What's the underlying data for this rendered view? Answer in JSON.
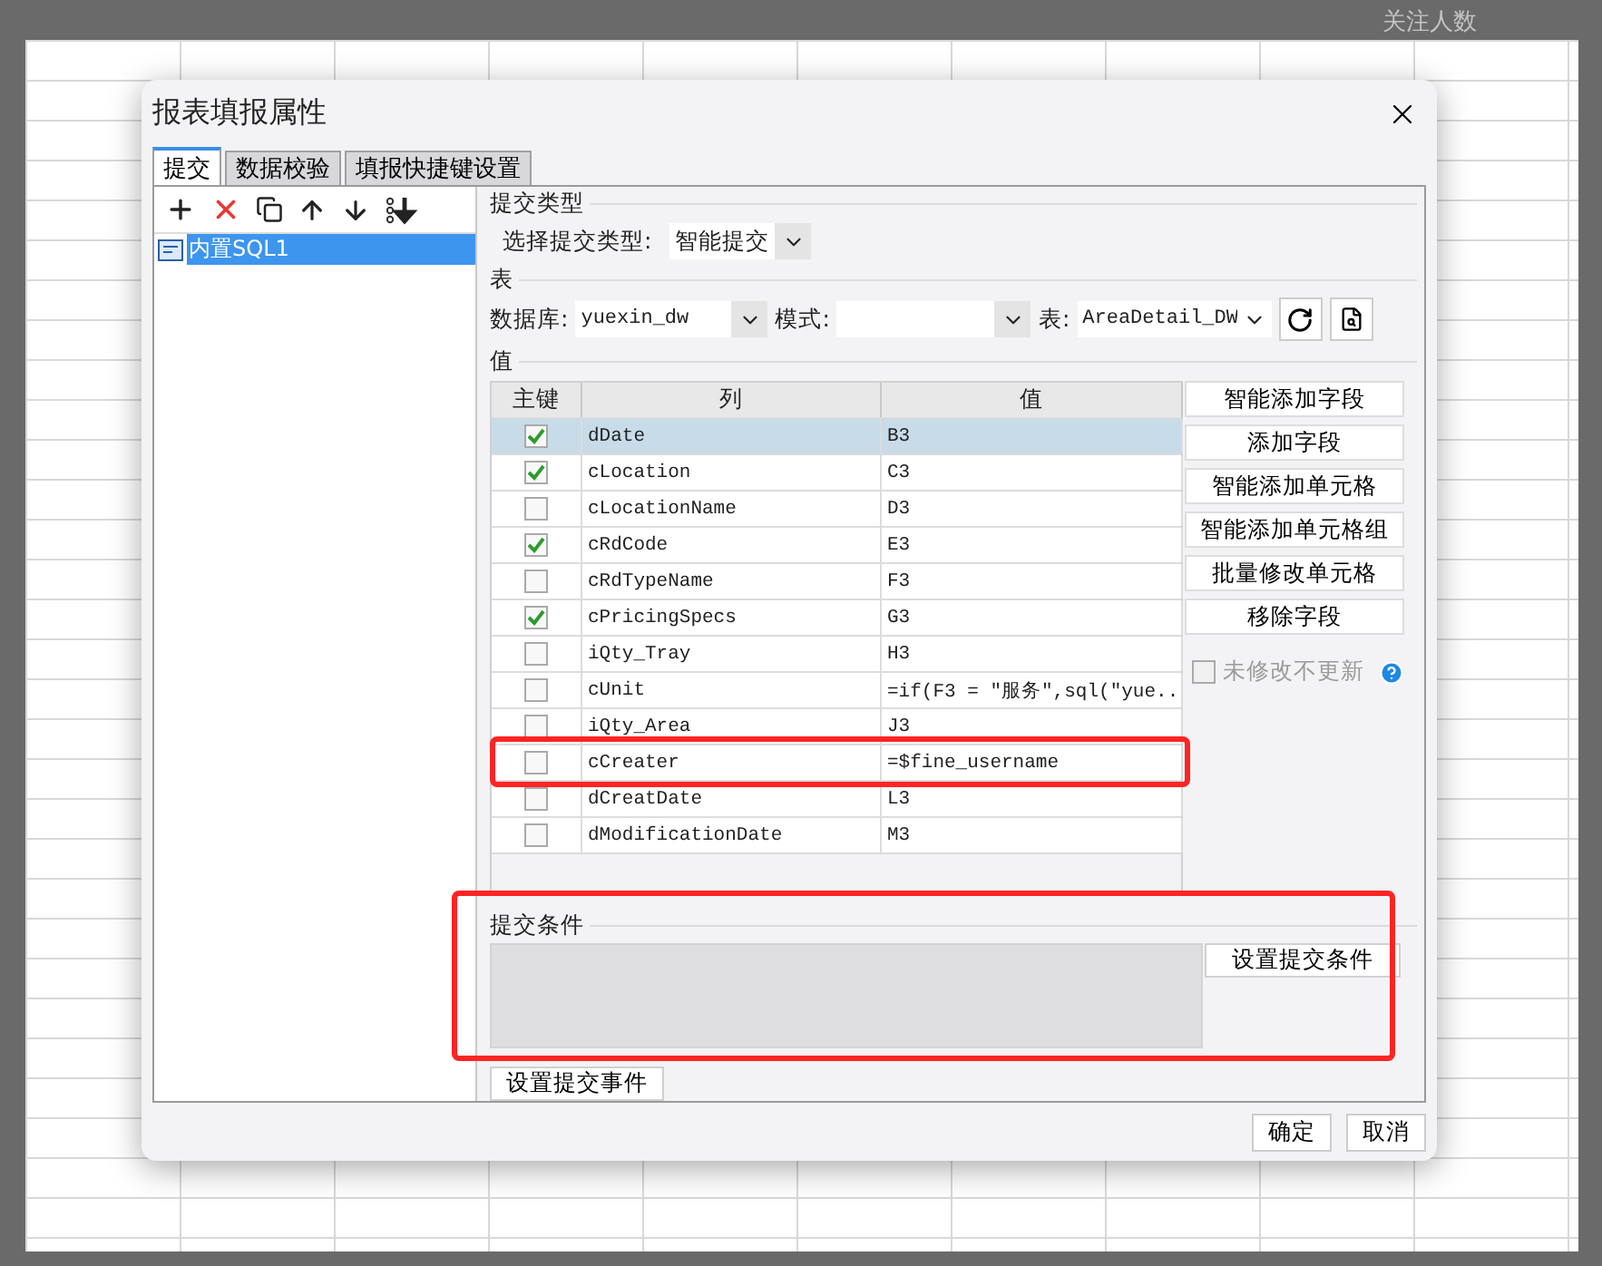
{
  "background": {
    "header": "关注人数"
  },
  "dialog": {
    "title": "报表填报属性",
    "tabs": [
      {
        "label": "提交",
        "selected": true
      },
      {
        "label": "数据校验",
        "selected": false
      },
      {
        "label": "填报快捷键设置",
        "selected": false
      }
    ],
    "tree": [
      {
        "label": "内置SQL1",
        "selected": true
      }
    ],
    "submit_type": {
      "heading": "提交类型",
      "label": "选择提交类型:",
      "value": "智能提交"
    },
    "table_section": {
      "heading": "表",
      "database_label": "数据库:",
      "database": "yuexin_dw",
      "schema_label": "模式:",
      "table_label": "表:",
      "table": "AreaDetail_DW"
    },
    "values": {
      "heading": "值",
      "columns": [
        "主键",
        "列",
        "值"
      ],
      "rows": [
        {
          "key": true,
          "column": "dDate",
          "value": "B3",
          "selected": true
        },
        {
          "key": true,
          "column": "cLocation",
          "value": "C3",
          "selected": false
        },
        {
          "key": false,
          "column": "cLocationName",
          "value": "D3",
          "selected": false
        },
        {
          "key": true,
          "column": "cRdCode",
          "value": "E3",
          "selected": false
        },
        {
          "key": false,
          "column": "cRdTypeName",
          "value": "F3",
          "selected": false
        },
        {
          "key": true,
          "column": "cPricingSpecs",
          "value": "G3",
          "selected": false
        },
        {
          "key": false,
          "column": "iQty_Tray",
          "value": "H3",
          "selected": false
        },
        {
          "key": false,
          "column": "cUnit",
          "value": "=if(F3 = \"服务\",sql(\"yue...",
          "selected": false
        },
        {
          "key": false,
          "column": "iQty_Area",
          "value": "J3",
          "selected": false
        },
        {
          "key": false,
          "column": "cCreater",
          "value": "=$fine_username",
          "selected": false
        },
        {
          "key": false,
          "column": "dCreatDate",
          "value": "L3",
          "selected": false
        },
        {
          "key": false,
          "column": "dModificationDate",
          "value": "M3",
          "selected": false
        }
      ]
    },
    "side_buttons": [
      "智能添加字段",
      "添加字段",
      "智能添加单元格",
      "智能添加单元格组",
      "批量修改单元格",
      "移除字段"
    ],
    "unchanged_option": {
      "label": "未修改不更新",
      "checked": false,
      "disabled": true
    },
    "condition": {
      "heading": "提交条件",
      "button": "设置提交条件"
    },
    "event_button": "设置提交事件",
    "footer_buttons": [
      "确定",
      "取消"
    ]
  }
}
